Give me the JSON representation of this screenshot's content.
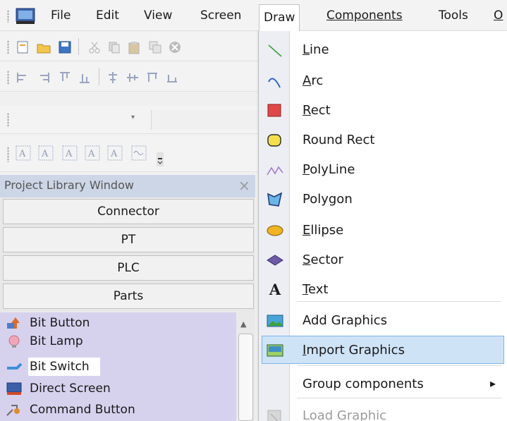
{
  "menubar": {
    "file": "File",
    "edit": "Edit",
    "view": "View",
    "screen": "Screen",
    "draw": "Draw",
    "components": "Components",
    "tools": "Tools",
    "more": "O"
  },
  "toolbar": {
    "combo_value": "",
    "icons": [
      "new-icon",
      "open-icon",
      "save-icon",
      "cut-icon",
      "copy-icon",
      "paste-icon",
      "duplicate-icon",
      "delete-icon"
    ]
  },
  "project_library": {
    "title": "Project Library Window",
    "close": "×",
    "sections": [
      "Connector",
      "PT",
      "PLC",
      "Parts"
    ],
    "items": [
      "Bit Button",
      "Bit Lamp",
      "Bit Switch",
      "Direct Screen",
      "Command Button"
    ]
  },
  "draw_menu": {
    "items": [
      {
        "label": "Line",
        "icon": "line-icon"
      },
      {
        "label": "Arc",
        "icon": "arc-icon"
      },
      {
        "label": "Rect",
        "icon": "rect-icon"
      },
      {
        "label": "Round Rect",
        "icon": "round-rect-icon"
      },
      {
        "label": "PolyLine",
        "icon": "polyline-icon"
      },
      {
        "label": "Polygon",
        "icon": "polygon-icon"
      },
      {
        "label": "Ellipse",
        "icon": "ellipse-icon"
      },
      {
        "label": "Sector",
        "icon": "sector-icon"
      },
      {
        "label": "Text",
        "icon": "text-icon"
      },
      {
        "label": "Add Graphics",
        "icon": "add-graphics-icon"
      },
      {
        "label": "Import Graphics",
        "icon": "import-graphics-icon"
      },
      {
        "label": "Group components",
        "icon": "submenu-arrow-icon"
      },
      {
        "label": "Load Graphic",
        "icon": "load-graphic-icon"
      }
    ],
    "highlighted": "Import Graphics",
    "text_glyph": "A",
    "submenu_arrow": "▸"
  },
  "colors": {
    "menu_highlight": "#cfe3f7",
    "library_header": "#cdd6e6",
    "library_list": "#d6d2ee",
    "rect_red": "#e04848",
    "round_rect_yellow": "#f4e04a",
    "ellipse_orange": "#f2b320",
    "sector_purple": "#6e5aa8"
  }
}
